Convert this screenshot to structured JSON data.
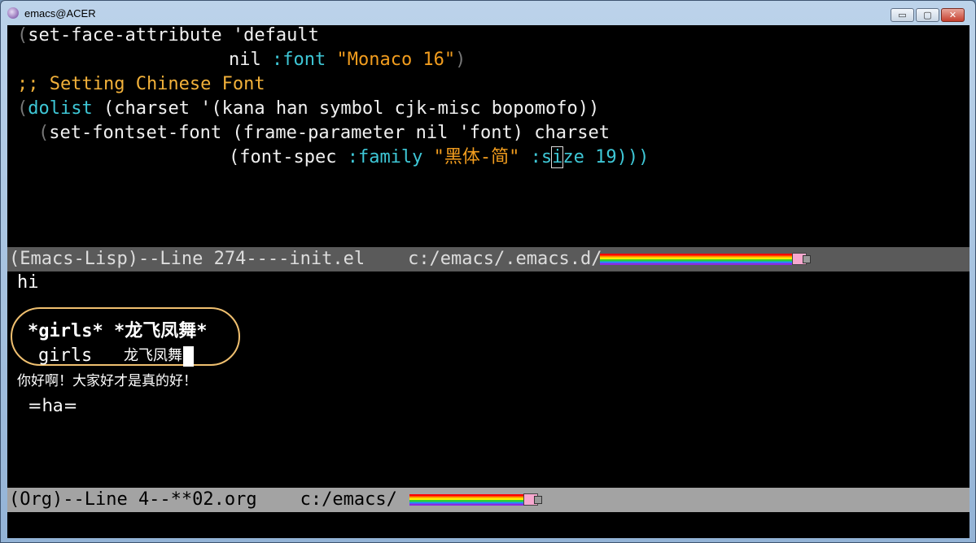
{
  "window": {
    "title": "emacs@ACER",
    "buttons": {
      "minimize": "▭",
      "maximize": "▢",
      "close": "✕"
    }
  },
  "upper_buffer": {
    "lines": {
      "l1": "set-face-attribute 'default",
      "l2a": "nil ",
      "l2b": ":font ",
      "l2c": "\"Monaco 16\"",
      "l3": ";; Setting Chinese Font",
      "l4a": "dolist",
      "l4b": " (charset '(kana han symbol cjk-misc bopomofo))",
      "l5": "set-fontset-font (frame-parameter nil 'font) charset",
      "l6a": "(font-spec ",
      "l6b": ":family ",
      "l6c": "\"黑体-简\"",
      "l6d": " :s",
      "l6e": "i",
      "l6f": "ze 19)))"
    }
  },
  "modeline_upper": {
    "text": "(Emacs-Lisp)--Line 274----init.el    c:/emacs/.emacs.d/"
  },
  "lower_buffer": {
    "hi": "hi",
    "heading": "*girls* *龙飞凤舞*",
    "row_girls": "girls",
    "row_cn": "龙飞凤舞",
    "chinese_line": "你好啊！大家好才是真的好！",
    "verbatim": "=ha="
  },
  "modeline_lower": {
    "text": "(Org)--Line 4--**02.org    c:/emacs/"
  },
  "colors": {
    "keyword": "#3ec7d6",
    "string": "#f29d1e",
    "comment": "#f2b13a",
    "annotation": "#f0c070"
  }
}
